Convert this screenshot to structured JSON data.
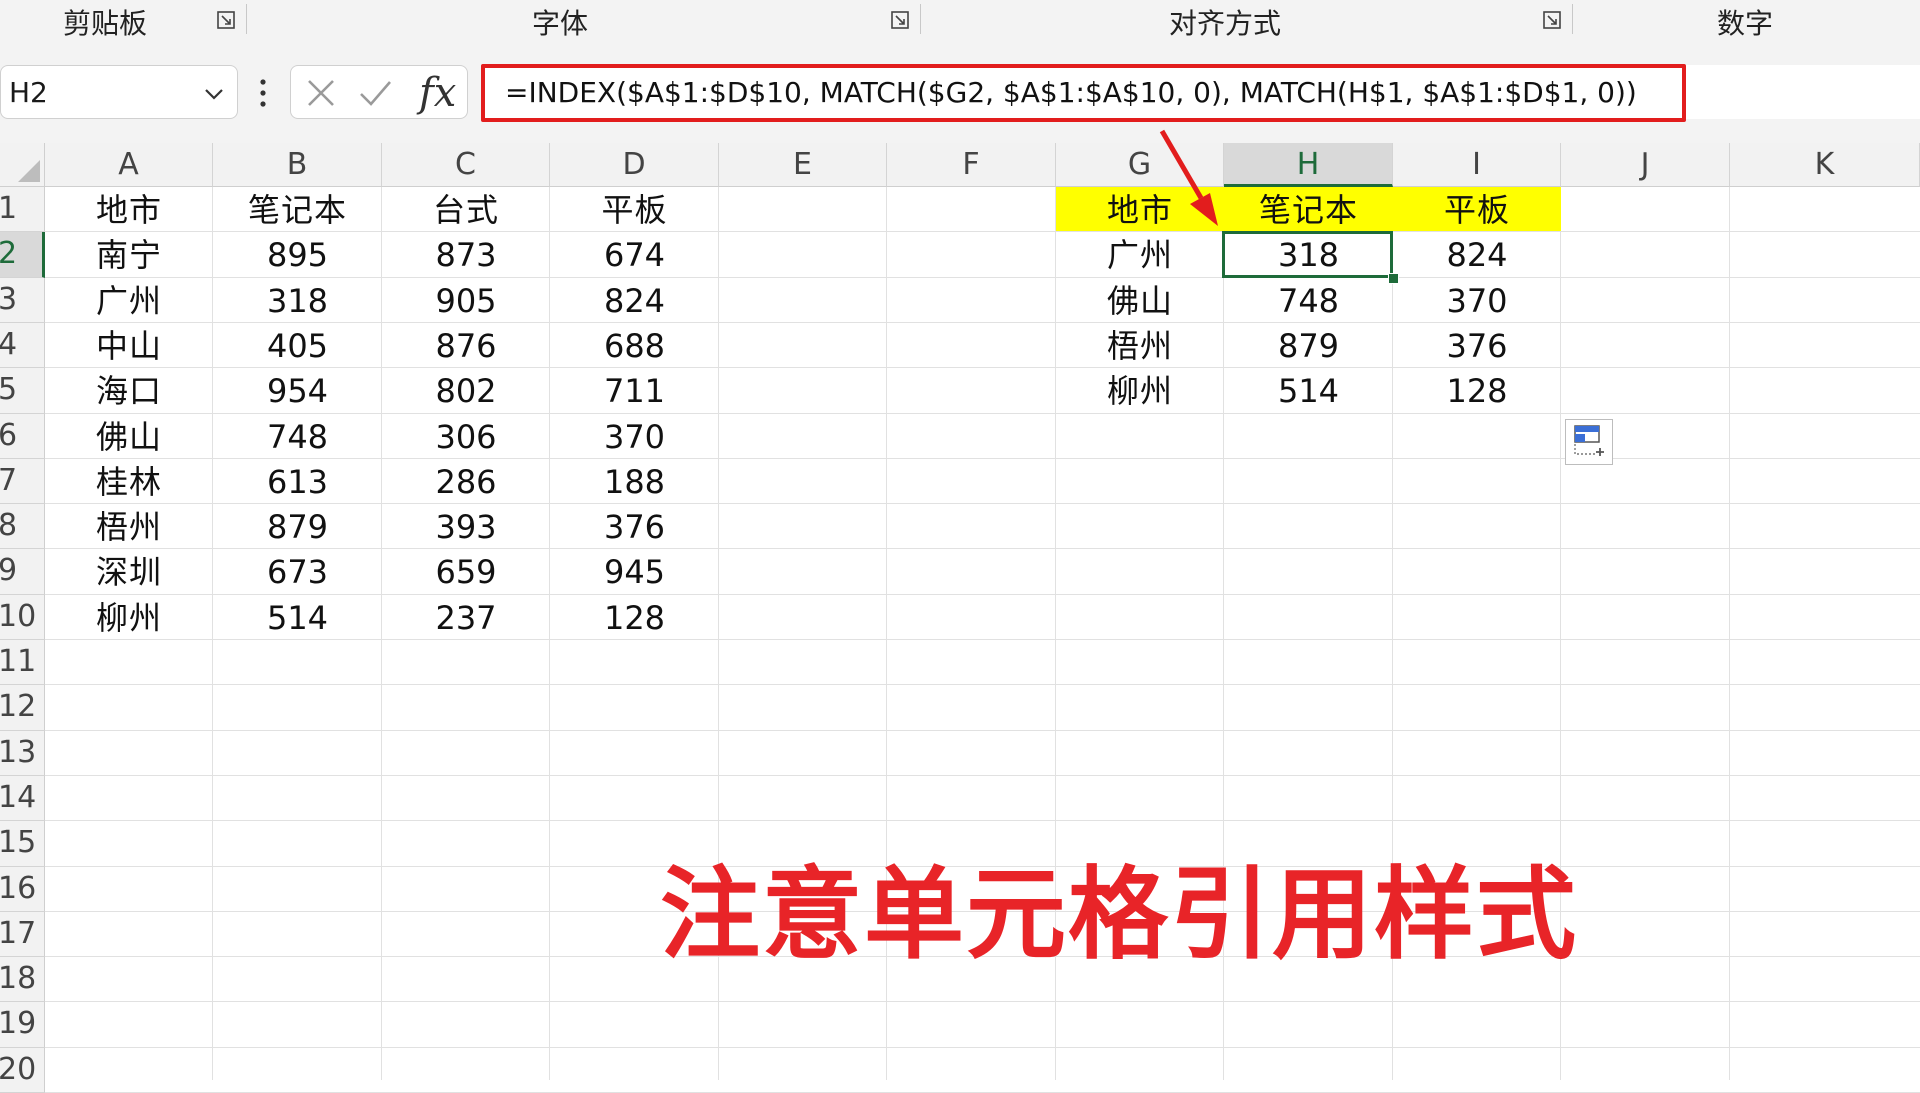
{
  "ribbon": {
    "groups": [
      {
        "label": "剪贴板"
      },
      {
        "label": "字体"
      },
      {
        "label": "对齐方式"
      },
      {
        "label": "数字"
      }
    ]
  },
  "formula_bar": {
    "name_box": "H2",
    "fx_label": "fx",
    "formula": "=INDEX($A$1:$D$10, MATCH($G2, $A$1:$A$10, 0), MATCH(H$1, $A$1:$D$1, 0))"
  },
  "grid": {
    "columns": [
      "A",
      "B",
      "C",
      "D",
      "E",
      "F",
      "G",
      "H",
      "I",
      "J",
      "K"
    ],
    "rows": [
      "1",
      "2",
      "3",
      "4",
      "5",
      "6",
      "7",
      "8",
      "9",
      "10",
      "11",
      "12",
      "13",
      "14",
      "15",
      "16",
      "17",
      "18",
      "19",
      "20"
    ],
    "selected_column": "H",
    "selected_row": "2",
    "active_cell": "H2"
  },
  "source_table": {
    "headers": [
      "地市",
      "笔记本",
      "台式",
      "平板"
    ],
    "rows": [
      [
        "南宁",
        "895",
        "873",
        "674"
      ],
      [
        "广州",
        "318",
        "905",
        "824"
      ],
      [
        "中山",
        "405",
        "876",
        "688"
      ],
      [
        "海口",
        "954",
        "802",
        "711"
      ],
      [
        "佛山",
        "748",
        "306",
        "370"
      ],
      [
        "桂林",
        "613",
        "286",
        "188"
      ],
      [
        "梧州",
        "879",
        "393",
        "376"
      ],
      [
        "深圳",
        "673",
        "659",
        "945"
      ],
      [
        "柳州",
        "514",
        "237",
        "128"
      ]
    ]
  },
  "lookup_table": {
    "headers": [
      "地市",
      "笔记本",
      "平板"
    ],
    "header_fill": "#ffff00",
    "rows": [
      [
        "广州",
        "318",
        "824"
      ],
      [
        "佛山",
        "748",
        "370"
      ],
      [
        "梧州",
        "879",
        "376"
      ],
      [
        "柳州",
        "514",
        "128"
      ]
    ]
  },
  "annotation": {
    "text": "注意单元格引用样式",
    "color": "#e82428"
  },
  "colors": {
    "highlight_box": "#e21d1d",
    "selection": "#1e6b3a"
  }
}
